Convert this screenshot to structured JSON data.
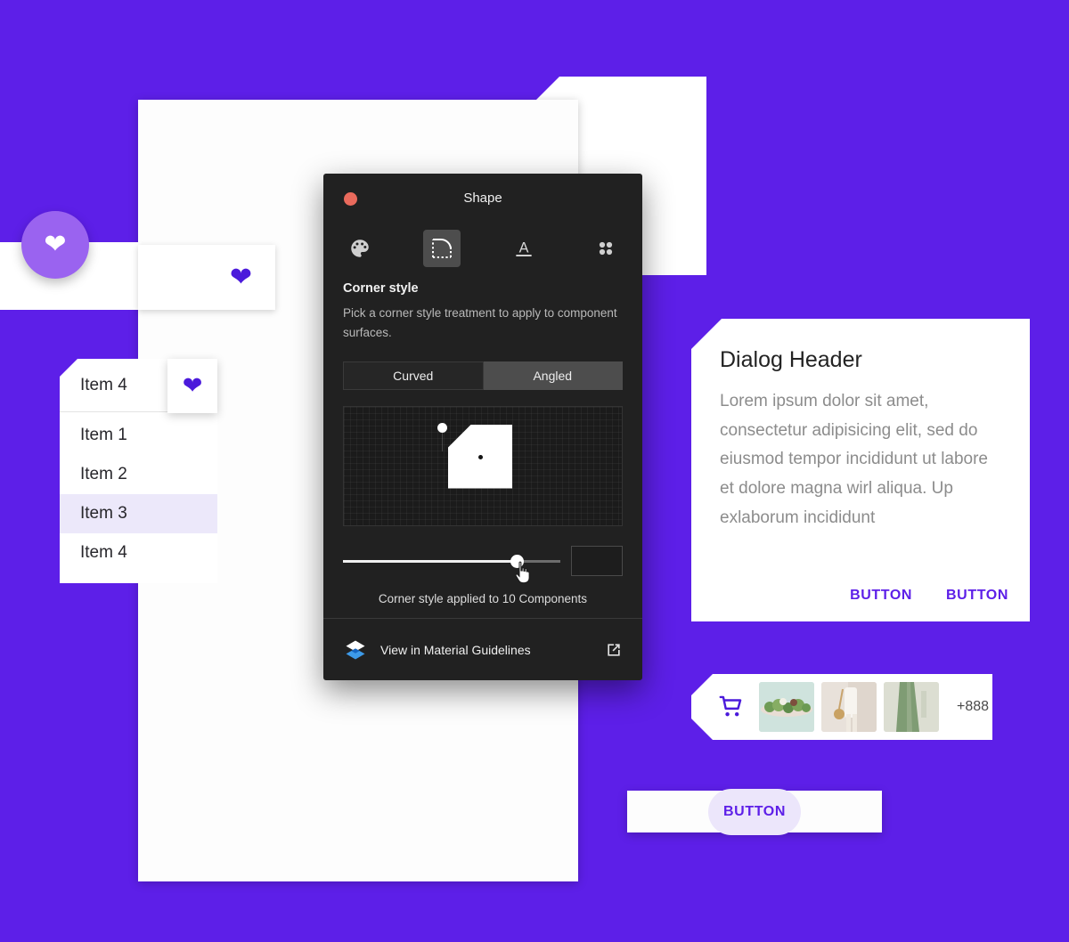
{
  "theme": {
    "background": "#5D1FE8",
    "accent": "#5D1FE8",
    "heart_accent": "#4B1ADB",
    "fab": "#9A63F0",
    "dialog_bg": "#212121",
    "close_dot": "#e96a5c"
  },
  "heart_card": {
    "fab_icon": "heart-icon",
    "trailing_icon": "heart-icon"
  },
  "dropdown": {
    "selected_value": "Item 4",
    "trailing_icon": "heart-icon",
    "options": [
      {
        "label": "Item 1",
        "selected": false
      },
      {
        "label": "Item 2",
        "selected": false
      },
      {
        "label": "Item 3",
        "selected": true
      },
      {
        "label": "Item 4",
        "selected": false
      }
    ]
  },
  "shape_dialog": {
    "title": "Shape",
    "close_icon": "close-dot-icon",
    "toolbar": [
      {
        "name": "palette-icon",
        "label": "Color",
        "active": false
      },
      {
        "name": "corner-shape-icon",
        "label": "Shape",
        "active": true
      },
      {
        "name": "typography-icon",
        "label": "Typography",
        "active": false
      },
      {
        "name": "grid-dots-icon",
        "label": "Components",
        "active": false
      }
    ],
    "section_title": "Corner style",
    "section_description": "Pick a corner style treatment to apply to component surfaces.",
    "segments": [
      {
        "label": "Curved",
        "active": false
      },
      {
        "label": "Angled",
        "active": true
      }
    ],
    "slider": {
      "value_percent": 80,
      "input_value": ""
    },
    "applied_text": "Corner style applied to 10 Components",
    "footer": {
      "logo_icon": "material-logo-icon",
      "label": "View in Material Guidelines",
      "external_icon": "external-link-icon"
    }
  },
  "dialog_card": {
    "title": "Dialog Header",
    "body": "Lorem ipsum dolor sit amet, consectetur adipisicing elit, sed do eiusmod tempor incididunt ut labore et dolore magna wirl aliqua. Up exlaborum incididunt",
    "actions": [
      {
        "label": "BUTTON"
      },
      {
        "label": "BUTTON"
      }
    ]
  },
  "cart_strip": {
    "cart_icon": "shopping-cart-icon",
    "thumbnails": [
      {
        "name": "thumbnail-greenery"
      },
      {
        "name": "thumbnail-outfit"
      },
      {
        "name": "thumbnail-green-dress"
      }
    ],
    "more_count": "+888"
  },
  "flat_button": {
    "label": "BUTTON"
  }
}
